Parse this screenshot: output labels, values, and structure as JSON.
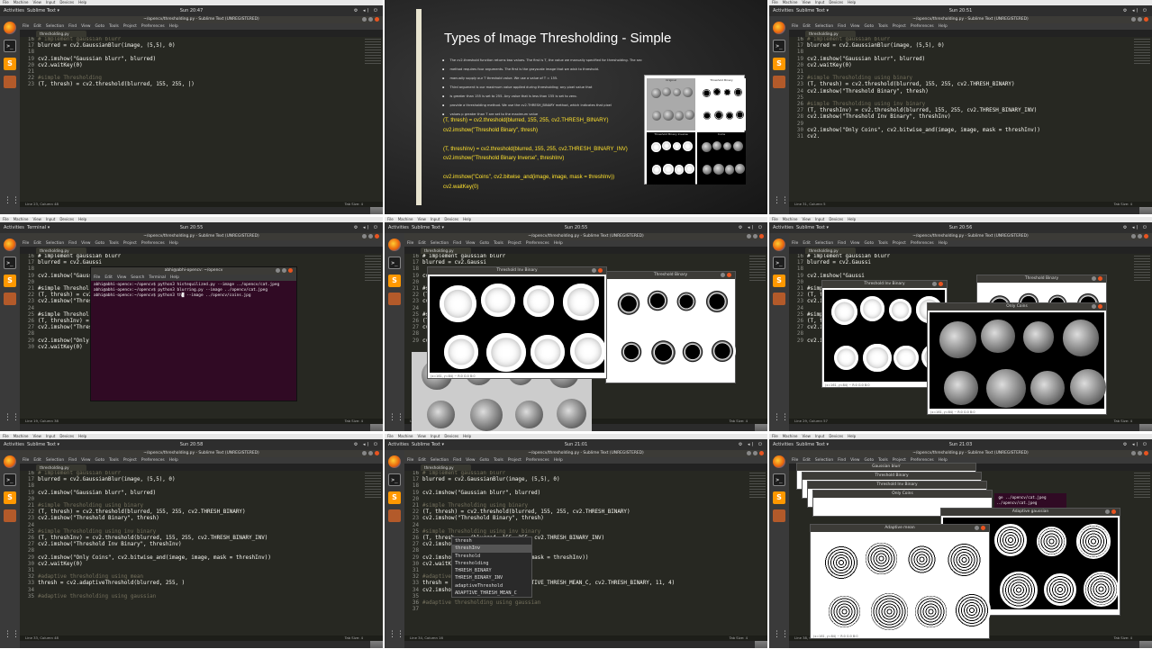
{
  "topbar": {
    "activities": "Activities",
    "app_sublime": "Sublime Text ▾",
    "app_terminal": "Terminal ▾",
    "tray": "⚙ ◂) ⏻"
  },
  "vbox_menu": [
    "File",
    "Machine",
    "View",
    "Input",
    "Devices",
    "Help"
  ],
  "sublime": {
    "title": "~/opencv/thresholding.py - Sublime Text (UNREGISTERED)",
    "menu": [
      "File",
      "Edit",
      "Selection",
      "Find",
      "View",
      "Goto",
      "Tools",
      "Project",
      "Preferences",
      "Help"
    ],
    "tab": "thresholding.py",
    "tab_size": "Tab Size: 4"
  },
  "dock_icons": [
    "firefox-icon",
    "terminal-icon",
    "sublime-icon",
    "shotwell-icon",
    "apps-grid-icon"
  ],
  "panels": [
    {
      "id": "p1",
      "clock": "Sun 20:47",
      "status": "Line 23, Column 48",
      "lines": [
        {
          "n": "16",
          "t": "# implement gaussian blurr",
          "c": "cm"
        },
        {
          "n": "17",
          "t": "blurred = cv2.GaussianBlur(image, (5,5), 0)",
          "c": ""
        },
        {
          "n": "18",
          "t": "",
          "c": ""
        },
        {
          "n": "19",
          "t": "cv2.imshow(\"Gaussian blurr\", blurred)",
          "c": ""
        },
        {
          "n": "20",
          "t": "cv2.waitKey(0)",
          "c": ""
        },
        {
          "n": "21",
          "t": "",
          "c": ""
        },
        {
          "n": "22",
          "t": "#simple Thresholding",
          "c": "cm"
        },
        {
          "n": "23",
          "t": "(T, thresh) = cv2.threshold(blurred, 155, 255, |)",
          "c": ""
        }
      ]
    },
    {
      "id": "p3",
      "clock": "Sun 20:51",
      "status": "Line 31, Column 5",
      "lines": [
        {
          "n": "16",
          "t": "# implement gaussian blurr",
          "c": "cm"
        },
        {
          "n": "17",
          "t": "blurred = cv2.GaussianBlur(image, (5,5), 0)",
          "c": ""
        },
        {
          "n": "18",
          "t": "",
          "c": ""
        },
        {
          "n": "19",
          "t": "cv2.imshow(\"Gaussian blurr\", blurred)",
          "c": ""
        },
        {
          "n": "20",
          "t": "cv2.waitKey(0)",
          "c": ""
        },
        {
          "n": "21",
          "t": "",
          "c": ""
        },
        {
          "n": "22",
          "t": "#simple Thresholding using binary",
          "c": "cm"
        },
        {
          "n": "23",
          "t": "(T, thresh) = cv2.threshold(blurred, 155, 255, cv2.THRESH_BINARY)",
          "c": ""
        },
        {
          "n": "24",
          "t": "cv2.imshow(\"Threshold Binary\", thresh)",
          "c": ""
        },
        {
          "n": "25",
          "t": "",
          "c": ""
        },
        {
          "n": "26",
          "t": "#simple Thresholding using inv binary",
          "c": "cm"
        },
        {
          "n": "27",
          "t": "(T, threshInv) = cv2.threshold(blurred, 155, 255, cv2.THRESH_BINARY_INV)",
          "c": ""
        },
        {
          "n": "28",
          "t": "cv2.imshow(\"Threshold Inv Binary\", threshInv)",
          "c": ""
        },
        {
          "n": "29",
          "t": "",
          "c": ""
        },
        {
          "n": "30",
          "t": "cv2.imshow(\"Only Coins\", cv2.bitwise_and(image, image, mask = threshInv))",
          "c": ""
        },
        {
          "n": "31",
          "t": "cv2.",
          "c": ""
        }
      ]
    },
    {
      "id": "p7",
      "clock": "Sun 20:58",
      "status": "Line 33, Column 48",
      "lines": [
        {
          "n": "16",
          "t": "# implement gaussian blurr",
          "c": "cm"
        },
        {
          "n": "17",
          "t": "blurred = cv2.GaussianBlur(image, (5,5), 0)",
          "c": ""
        },
        {
          "n": "18",
          "t": "",
          "c": ""
        },
        {
          "n": "19",
          "t": "cv2.imshow(\"Gaussian blurr\", blurred)",
          "c": ""
        },
        {
          "n": "20",
          "t": "",
          "c": ""
        },
        {
          "n": "21",
          "t": "#simple Thresholding using binary",
          "c": "cm"
        },
        {
          "n": "22",
          "t": "(T, thresh) = cv2.threshold(blurred, 155, 255, cv2.THRESH_BINARY)",
          "c": ""
        },
        {
          "n": "23",
          "t": "cv2.imshow(\"Threshold Binary\", thresh)",
          "c": ""
        },
        {
          "n": "24",
          "t": "",
          "c": ""
        },
        {
          "n": "25",
          "t": "#simple Thresholding using inv binary",
          "c": "cm"
        },
        {
          "n": "26",
          "t": "(T, threshInv) = cv2.threshold(blurred, 155, 255, cv2.THRESH_BINARY_INV)",
          "c": ""
        },
        {
          "n": "27",
          "t": "cv2.imshow(\"Threshold Inv Binary\", threshInv)",
          "c": ""
        },
        {
          "n": "28",
          "t": "",
          "c": ""
        },
        {
          "n": "29",
          "t": "cv2.imshow(\"Only Coins\", cv2.bitwise_and(image, image, mask = threshInv))",
          "c": ""
        },
        {
          "n": "30",
          "t": "cv2.waitKey(0)",
          "c": ""
        },
        {
          "n": "31",
          "t": "",
          "c": ""
        },
        {
          "n": "32",
          "t": "#adaptive thresholding using mean",
          "c": "cm"
        },
        {
          "n": "33",
          "t": "thresh = cv2.adaptiveThreshold(blurred, 255, )",
          "c": ""
        },
        {
          "n": "34",
          "t": "",
          "c": ""
        },
        {
          "n": "35",
          "t": "#adaptive thresholding using gaussian",
          "c": "cm"
        }
      ]
    },
    {
      "id": "p8",
      "clock": "Sun 21:01",
      "status": "Line 34, Column 16",
      "lines": [
        {
          "n": "16",
          "t": "# implement gaussian blurr",
          "c": "cm"
        },
        {
          "n": "17",
          "t": "blurred = cv2.GaussianBlur(image, (5,5), 0)",
          "c": ""
        },
        {
          "n": "18",
          "t": "",
          "c": ""
        },
        {
          "n": "19",
          "t": "cv2.imshow(\"Gaussian blurr\", blurred)",
          "c": ""
        },
        {
          "n": "20",
          "t": "",
          "c": ""
        },
        {
          "n": "21",
          "t": "#simple Thresholding using binary",
          "c": "cm"
        },
        {
          "n": "22",
          "t": "(T, thresh) = cv2.threshold(blurred, 155, 255, cv2.THRESH_BINARY)",
          "c": ""
        },
        {
          "n": "23",
          "t": "cv2.imshow(\"Threshold Binary\", thresh)",
          "c": ""
        },
        {
          "n": "24",
          "t": "",
          "c": ""
        },
        {
          "n": "25",
          "t": "#simple Thresholding using inv binary",
          "c": "cm"
        },
        {
          "n": "26",
          "t": "(T, thresh     (blurred, 155, 255, cv2.THRESH_BINARY_INV)",
          "c": ""
        },
        {
          "n": "27",
          "t": "cv2.imshow(     y\", threshInv)",
          "c": ""
        },
        {
          "n": "28",
          "t": "",
          "c": ""
        },
        {
          "n": "29",
          "t": "cv2.imshow(     and(image, image, mask = threshInv))",
          "c": ""
        },
        {
          "n": "30",
          "t": "cv2.waitKe",
          "c": ""
        },
        {
          "n": "31",
          "t": "",
          "c": ""
        },
        {
          "n": "32",
          "t": "#adaptive",
          "c": "cm"
        },
        {
          "n": "33",
          "t": "thresh =          ), 255, cv2.ADAPTIVE_THRESH_MEAN_C, cv2.THRESH_BINARY, 11, 4)",
          "c": ""
        },
        {
          "n": "34",
          "t": "cv2.imshow(thre)",
          "c": ""
        },
        {
          "n": "35",
          "t": "",
          "c": ""
        },
        {
          "n": "36",
          "t": "#adaptive thresholding using gaussian",
          "c": "cm"
        },
        {
          "n": "37",
          "t": "",
          "c": ""
        }
      ]
    }
  ],
  "autocomplete": [
    "thresh",
    "threshInv",
    "Threshold",
    "Thresholding",
    "THRESH_BINARY",
    "THRESH_BINARY_INV",
    "adaptiveThreshold",
    "ADAPTIVE_THRESH_MEAN_C"
  ],
  "slide": {
    "title": "Types of Image Thresholding - Simple",
    "bullets": [
      "The cv2.threshold function returns two values. The first is T, the value we manually specified for thresholding. The second is our actual thresholded image",
      "method requires four arguments. The first is the grayscale image that we wish to threshold.",
      "manually supply our T threshold value. We use a value of T = 155.",
      "Third argument is our maximum value applied during thresholding; any pixel value that",
      "is greater than 155 is set to 255. Any value that is less than 155 is set to zero.",
      "provide a thresholding method. We use the cv2.THRESH_BINARY method, which indicates that pixel",
      "values p greater than T are set to the maximum value"
    ],
    "code": [
      "(T, thresh) = cv2.threshold(blurred, 155, 255, cv2.THRESH_BINARY)",
      "cv2.imshow(\"Threshold Binary\", thresh)",
      "",
      "(T, threshInv) = cv2.threshold(blurred, 155, 255, cv2.THRESH_BINARY_INV)",
      "cv2.imshow(\"Threshold Binary Inverse\", threshInv)",
      "",
      "cv2.imshow(\"Coins\", cv2.bitwise_and(image, image, mask = threshInv))",
      "cv2.waitKey(0)"
    ],
    "photo_labels": [
      "Original",
      "Threshold Binary",
      "Threshold Binary Inverse",
      "Coins"
    ]
  },
  "terminal": {
    "clock": "Sun 20:55",
    "title": "abhi@abhi-opencv: ~/opencv",
    "menu": [
      "File",
      "Edit",
      "View",
      "Search",
      "Terminal",
      "Help"
    ],
    "lines": [
      "abhi@abhi-opencv:~/opencv$ python3 histequilized.py --image ../opencv/cat.jpeg",
      "abhi@abhi-opencv:~/opencv$ python3 blurring.py --image ../opencv/cat.jpeg",
      "abhi@abhi-opencv:~/opencv$ python3 th█ --image ../opencv/coins.jpg"
    ],
    "bg_lines": [
      {
        "n": "16",
        "t": "# implement gaussian blurr"
      },
      {
        "n": "17",
        "t": "blurred = cv2.Gaussi"
      },
      {
        "n": "18",
        "t": ""
      },
      {
        "n": "19",
        "t": "cv2.imshow(\"Gaussi"
      },
      {
        "n": "20",
        "t": ""
      },
      {
        "n": "21",
        "t": "#simple Threshol"
      },
      {
        "n": "22",
        "t": "(T, thresh) = cv2."
      },
      {
        "n": "23",
        "t": "cv2.imshow(\"Thresh"
      },
      {
        "n": "24",
        "t": ""
      },
      {
        "n": "25",
        "t": "#simple Threshol"
      },
      {
        "n": "26",
        "t": "(T, threshInv) = c"
      },
      {
        "n": "27",
        "t": "cv2.imshow(\"Thresh"
      },
      {
        "n": "28",
        "t": ""
      },
      {
        "n": "29",
        "t": "cv2.imshow(\"Only C"
      },
      {
        "n": "30",
        "t": "cv2.waitKey(0)"
      }
    ],
    "status": "Line 19, Column 38"
  },
  "imgwins": {
    "p5_clock": "Sun 20:55",
    "p6_clock": "Sun 20:56",
    "p9_clock": "Sun 21:03",
    "threshold_inv_binary": "Threshold Inv Binary",
    "threshold_binary": "Threshold Binary",
    "only_coins": "Only Coins",
    "gaussian_blurr": "Gaussian blurr",
    "adaptive_mean": "Adaptive mean",
    "adaptive_gaussian": "Adaptive gaussian",
    "footer": "(x=161, y=84) ~ R:0 G:0 B:0",
    "p9_term": [
      " ge ../opencv/cat.jpeg",
      "../opencv/cat.jpeg"
    ],
    "p5_status": "Line 29, Column 57",
    "p6_status": "Line 29, Column 57",
    "p9_status": "Line 38, Column 1"
  }
}
